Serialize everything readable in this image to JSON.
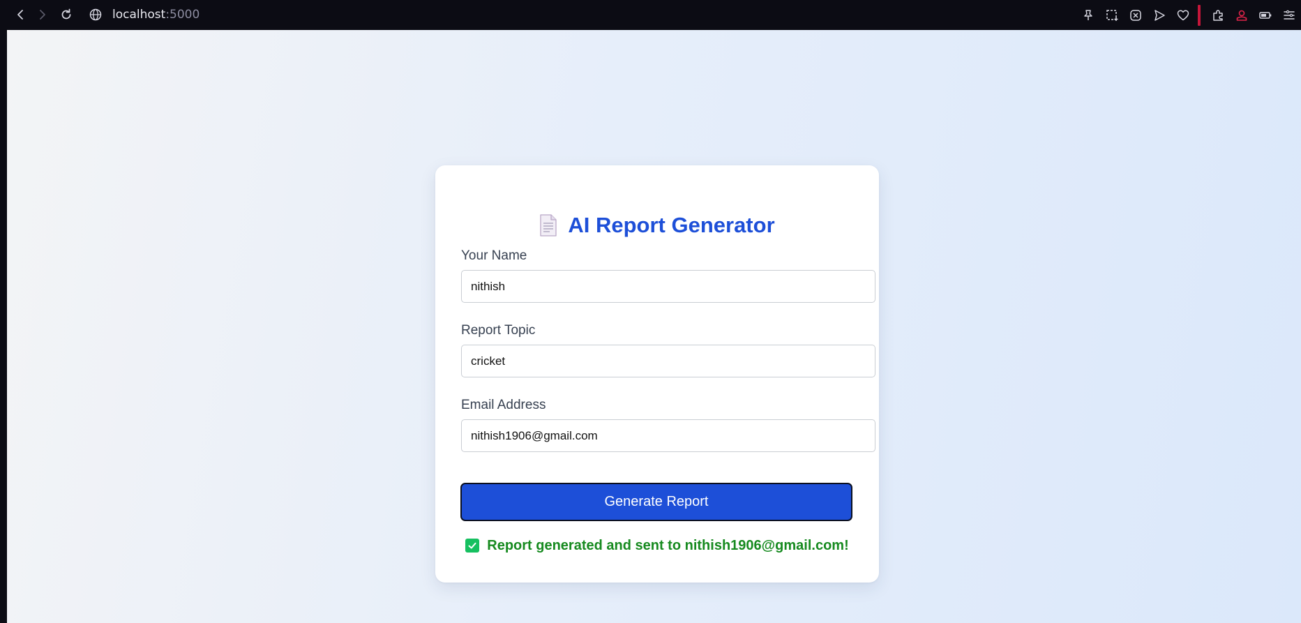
{
  "browser": {
    "url_host": "localhost",
    "url_port": ":5000",
    "nav_icons": [
      "back-arrow-icon",
      "forward-arrow-icon",
      "reload-icon",
      "globe-icon"
    ],
    "toolbar_icons": [
      "pin-icon",
      "screenshot-icon",
      "close-box-icon",
      "send-icon",
      "heart-icon",
      "extensions-icon",
      "profile-icon",
      "battery-icon",
      "menu-icon"
    ],
    "accent_color": "#c5163a"
  },
  "page": {
    "title": "AI Report Generator",
    "title_icon": "document-icon",
    "title_color": "#1d4fd8"
  },
  "form": {
    "name_label": "Your Name",
    "name_value": "nithish",
    "topic_label": "Report Topic",
    "topic_value": "cricket",
    "email_label": "Email Address",
    "email_value": "nithish1906@gmail.com",
    "submit_label": "Generate Report",
    "button_color": "#1d4fd8"
  },
  "status": {
    "icon": "check-box-icon",
    "message": "Report generated and sent to nithish1906@gmail.com!",
    "color": "#168a1f"
  }
}
